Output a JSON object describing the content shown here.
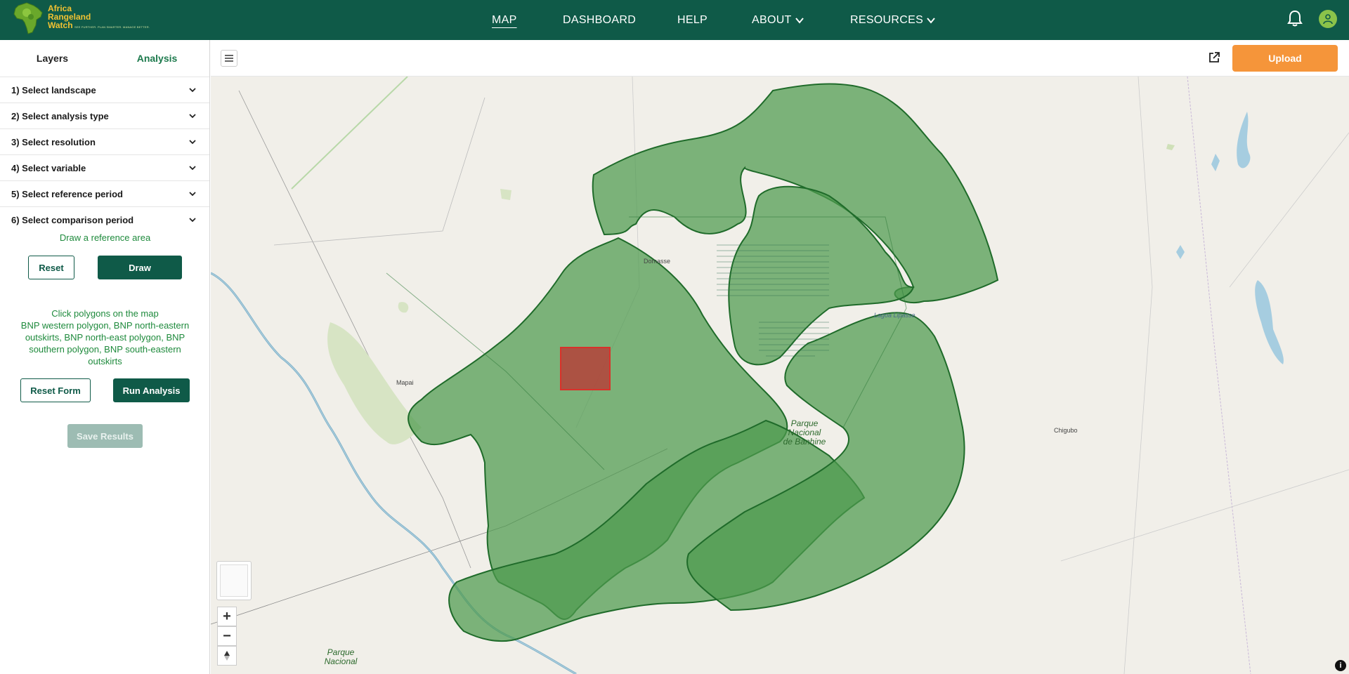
{
  "header": {
    "logo_line1": "Africa",
    "logo_line2": "Rangeland",
    "logo_line3": "Watch",
    "logo_tagline": "SEE FURTHER. PLAN SMARTER. MANAGE BETTER.",
    "nav": [
      {
        "label": "MAP",
        "active": true
      },
      {
        "label": "DASHBOARD",
        "active": false
      },
      {
        "label": "HELP",
        "active": false
      },
      {
        "label": "ABOUT",
        "active": false
      },
      {
        "label": "RESOURCES",
        "active": false
      }
    ]
  },
  "sidebar": {
    "tabs": [
      "Layers",
      "Analysis"
    ],
    "selected_tab": "Analysis",
    "steps": [
      "1) Select landscape",
      "2) Select analysis type",
      "3) Select resolution",
      "4) Select variable",
      "5) Select reference period",
      "6) Select comparison period"
    ],
    "draw_hint": "Draw a reference area",
    "reset_label": "Reset",
    "draw_label": "Draw",
    "click_hint": "Click polygons on the map",
    "selected_polygons": "BNP western polygon, BNP north-eastern outskirts, BNP north-east polygon, BNP southern polygon, BNP south-eastern outskirts",
    "reset_form_label": "Reset Form",
    "run_analysis_label": "Run Analysis",
    "save_results_label": "Save Results"
  },
  "toolbar": {
    "upload_label": "Upload"
  },
  "map": {
    "places": {
      "domasse": "Domasse",
      "mapai": "Mapai",
      "chigubo": "Chigubo",
      "lagoa": "Lagoa Lipasse",
      "park1_l1": "Parque",
      "park1_l2": "Nacional",
      "park1_l3": "de Banhine",
      "park2_l1": "Parque",
      "park2_l2": "Nacional"
    },
    "zoom_in": "+",
    "zoom_out": "−",
    "info": "i",
    "colors": {
      "polygon_fill": "#4e9a4e",
      "polygon_stroke": "#1f6b2a",
      "reference_fill": "#b5413a",
      "reference_stroke": "#d9322a"
    }
  }
}
